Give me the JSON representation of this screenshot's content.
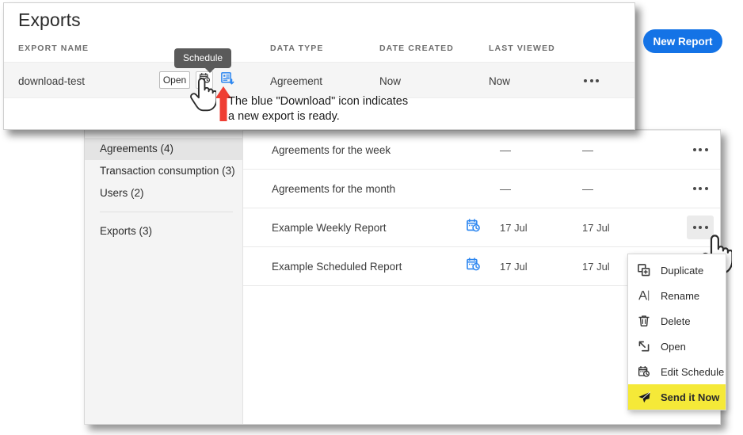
{
  "foreground_window": {
    "title": "Exports",
    "columns": [
      "EXPORT NAME",
      "DATA TYPE",
      "DATE CREATED",
      "LAST VIEWED"
    ],
    "row": {
      "name": "download-test",
      "open_label": "Open",
      "schedule_icon": "calendar-clock-icon",
      "download_icon": "download-document-icon",
      "data_type": "Agreement",
      "date_created": "Now",
      "last_viewed": "Now",
      "overflow": "ellipsis-icon"
    },
    "tooltip": "Schedule",
    "new_report_button": "New Report"
  },
  "annotation": {
    "line1": "The blue \"Download\" icon indicates",
    "line2": "a new export is ready.",
    "arrow_color": "#ef3e33"
  },
  "background_window": {
    "sidebar": {
      "group1": [
        {
          "label": "Agreements (4)",
          "selected": true
        },
        {
          "label": "Transaction consumption (3)",
          "selected": false
        },
        {
          "label": "Users (2)",
          "selected": false
        }
      ],
      "group2": [
        {
          "label": "Exports (3)",
          "selected": false
        }
      ]
    },
    "rows": [
      {
        "name": "Agreements for the week",
        "schedule_icon": "",
        "date_created": "—",
        "last_viewed": "—",
        "menu_hover": false
      },
      {
        "name": "Agreements for the month",
        "schedule_icon": "",
        "date_created": "—",
        "last_viewed": "—",
        "menu_hover": false
      },
      {
        "name": "Example Weekly Report",
        "schedule_icon": "calendar-clock-icon",
        "date_created": "17 Jul",
        "last_viewed": "17 Jul",
        "menu_hover": true
      },
      {
        "name": "Example Scheduled Report",
        "schedule_icon": "calendar-clock-icon",
        "date_created": "17 Jul",
        "last_viewed": "17 Jul",
        "menu_hover": false
      }
    ]
  },
  "context_menu": {
    "items": [
      {
        "label": "Duplicate",
        "icon": "duplicate-icon",
        "highlighted": false
      },
      {
        "label": "Rename",
        "icon": "rename-icon",
        "highlighted": false
      },
      {
        "label": "Delete",
        "icon": "trash-icon",
        "highlighted": false
      },
      {
        "label": "Open",
        "icon": "open-external-icon",
        "highlighted": false
      },
      {
        "label": "Edit Schedule",
        "icon": "calendar-clock-icon",
        "highlighted": false
      },
      {
        "label": "Send it Now",
        "icon": "paper-plane-icon",
        "highlighted": true
      }
    ]
  },
  "colors": {
    "accent_blue": "#1473e6",
    "highlight_yellow": "#f5e938",
    "annotation_red": "#ef3e33",
    "row_gray": "#f5f5f5",
    "sidebar_gray": "#f4f4f4"
  }
}
